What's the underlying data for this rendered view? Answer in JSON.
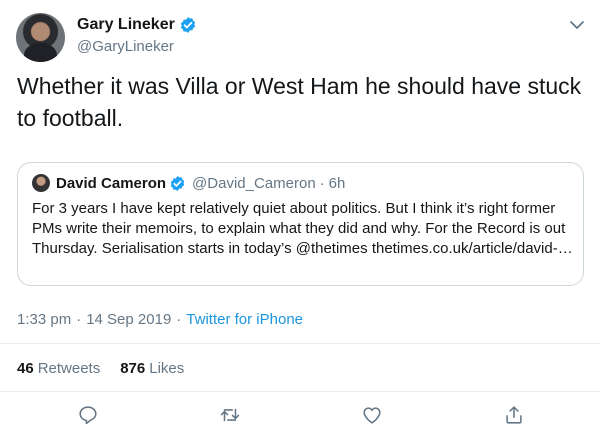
{
  "author": {
    "name": "Gary Lineker",
    "handle": "@GaryLineker",
    "verified_icon": "verified-badge-icon"
  },
  "tweet": {
    "text": "Whether it was Villa or West Ham he should have stuck to football."
  },
  "quoted_tweet": {
    "name": "David Cameron",
    "handle": "@David_Cameron",
    "separator": "·",
    "time": "6h",
    "text": "For 3 years I have kept relatively quiet about politics. But I think it’s right former PMs write their memoirs, to explain what they did and why. For the Record is out Thursday. Serialisation starts in today’s @thetimes thetimes.co.uk/article/david-…"
  },
  "meta": {
    "time": "1:33 pm",
    "separator": "·",
    "date": "14 Sep 2019",
    "source": "Twitter for iPhone"
  },
  "stats": {
    "retweets_count": "46",
    "retweets_label": "Retweets",
    "likes_count": "876",
    "likes_label": "Likes"
  },
  "actions": [
    "reply-icon",
    "retweet-icon",
    "like-icon",
    "share-icon"
  ],
  "colors": {
    "link": "#1b95e0",
    "verified": "#1da1f2",
    "secondary_text": "#657786",
    "border": "#ccd6dd"
  }
}
